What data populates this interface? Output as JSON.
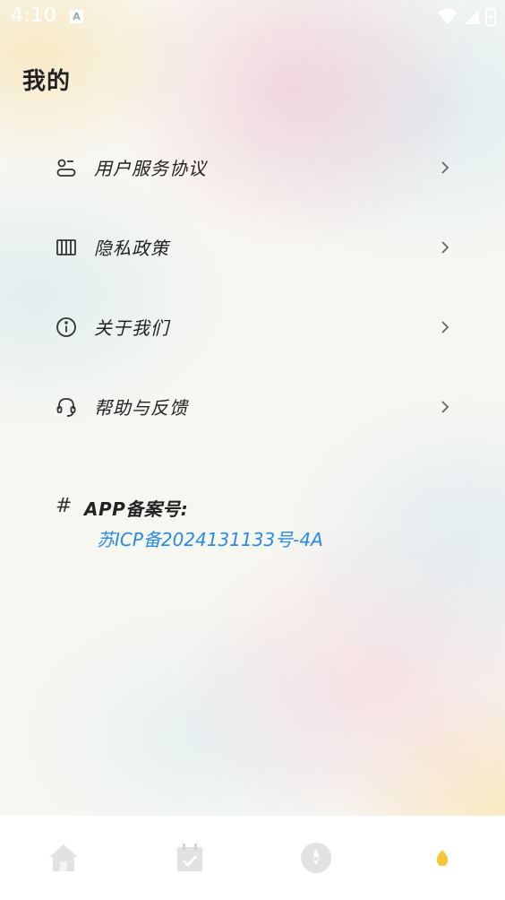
{
  "status_bar": {
    "time": "4:10",
    "notification_icon": "a-letter-icon",
    "icons": [
      "wifi-icon",
      "cellular-signal-icon",
      "battery-icon"
    ]
  },
  "page": {
    "title": "我的"
  },
  "menu": {
    "items": [
      {
        "label": "用户服务协议",
        "icon": "user-card-icon"
      },
      {
        "label": "隐私政策",
        "icon": "columns-icon"
      },
      {
        "label": "关于我们",
        "icon": "info-icon"
      },
      {
        "label": "帮助与反馈",
        "icon": "headset-icon"
      }
    ]
  },
  "record": {
    "label": "APP备案号:",
    "number": "苏ICP备2024131133号-4A",
    "icon": "hash-icon"
  },
  "tabbar": {
    "tabs": [
      {
        "icon": "home-icon",
        "active": false
      },
      {
        "icon": "calendar-check-icon",
        "active": false
      },
      {
        "icon": "compass-icon",
        "active": false
      },
      {
        "icon": "profile-drop-icon",
        "active": true
      }
    ],
    "active_color": "#f6c63c",
    "inactive_color": "#e2e2e2"
  },
  "colors": {
    "link": "#2b8be0",
    "text": "#222222"
  }
}
